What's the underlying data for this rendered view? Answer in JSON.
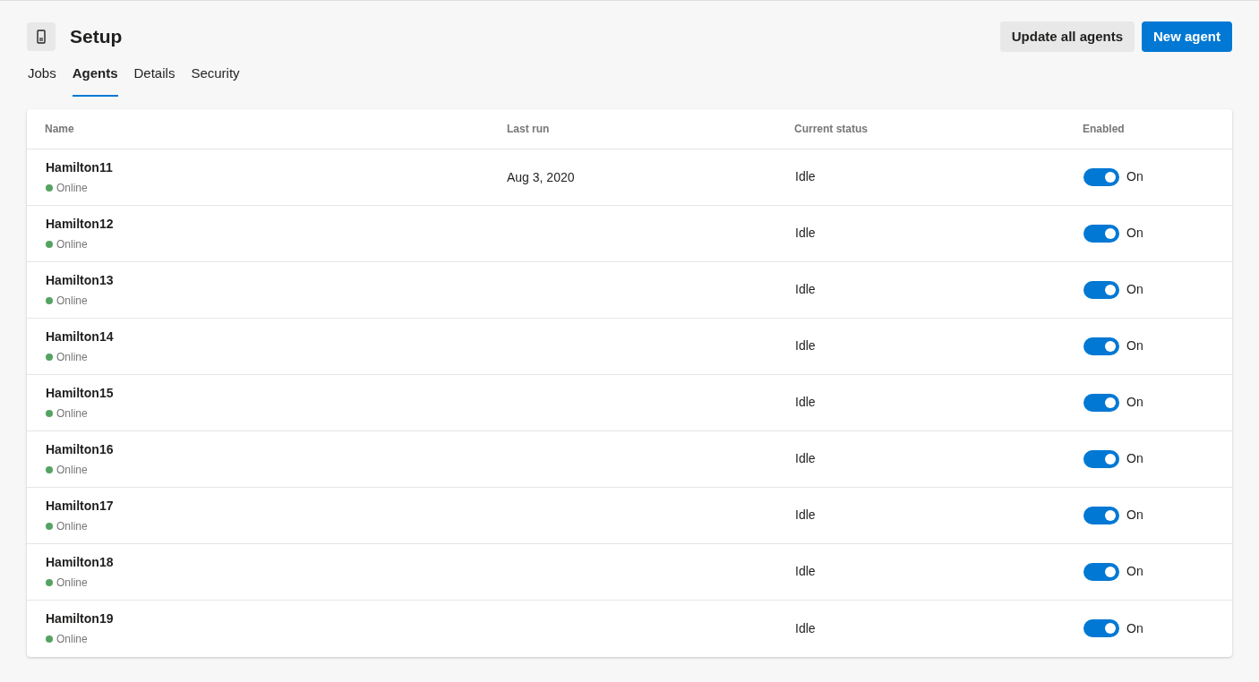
{
  "header": {
    "title": "Setup",
    "buttons": [
      {
        "label": "Update all agents",
        "kind": "secondary"
      },
      {
        "label": "New agent",
        "kind": "primary"
      }
    ]
  },
  "tabs": [
    {
      "label": "Jobs",
      "selected": false
    },
    {
      "label": "Agents",
      "selected": true
    },
    {
      "label": "Details",
      "selected": false
    },
    {
      "label": "Security",
      "selected": false
    }
  ],
  "table": {
    "columns": [
      "Name",
      "Last run",
      "Current status",
      "Enabled"
    ],
    "rows": [
      {
        "name": "Hamilton11",
        "presence": "Online",
        "color": "#55a362",
        "last_run": "Aug 3, 2020",
        "status": "Idle",
        "enabled": true,
        "enabled_label": "On"
      },
      {
        "name": "Hamilton12",
        "presence": "Online",
        "color": "#55a362",
        "status": "Idle",
        "enabled": true,
        "enabled_label": "On"
      },
      {
        "name": "Hamilton13",
        "presence": "Online",
        "color": "#55a362",
        "status": "Idle",
        "enabled": true,
        "enabled_label": "On"
      },
      {
        "name": "Hamilton14",
        "presence": "Online",
        "color": "#55a362",
        "status": "Idle",
        "enabled": true,
        "enabled_label": "On"
      },
      {
        "name": "Hamilton15",
        "presence": "Online",
        "color": "#55a362",
        "status": "Idle",
        "enabled": true,
        "enabled_label": "On"
      },
      {
        "name": "Hamilton16",
        "presence": "Online",
        "color": "#55a362",
        "status": "Idle",
        "enabled": true,
        "enabled_label": "On"
      },
      {
        "name": "Hamilton17",
        "presence": "Online",
        "color": "#55a362",
        "status": "Idle",
        "enabled": true,
        "enabled_label": "On"
      },
      {
        "name": "Hamilton18",
        "presence": "Online",
        "color": "#55a362",
        "status": "Idle",
        "enabled": true,
        "enabled_label": "On"
      },
      {
        "name": "Hamilton19",
        "presence": "Online",
        "color": "#55a362",
        "status": "Idle",
        "enabled": true,
        "enabled_label": "On"
      }
    ]
  }
}
